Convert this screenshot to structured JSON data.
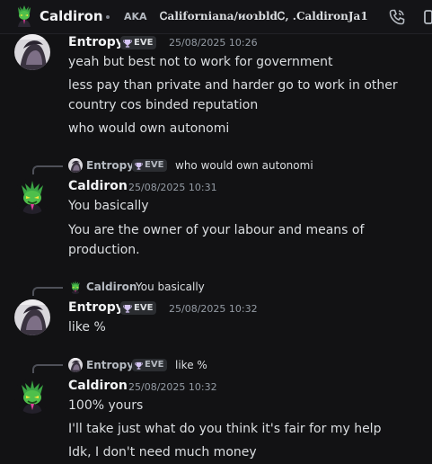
{
  "header": {
    "name": "Caldiron",
    "aka_label": "AKA",
    "alias": "Ꮯaliforniana/ᴎoɿbldᏟ, .CaldironJa1",
    "call_icon": "phone-call-icon",
    "more_icon": "more-icon"
  },
  "colors": {
    "background": "#121214",
    "badge_background": "#2b2d31",
    "timestamp": "#949ba4",
    "text": "#dbdee1"
  },
  "messages": [
    {
      "author": "Entropy",
      "badge": "EVE",
      "timestamp": "25/08/2025 10:26",
      "lines": [
        "yeah but best not to work for government",
        "less pay than private and harder go to work in other",
        "country cos binded reputation",
        "who would own autonomi"
      ]
    },
    {
      "reply": {
        "author": "Entropy",
        "badge": "EVE",
        "text": "who would own autonomi"
      },
      "author": "Caldiron",
      "timestamp": "25/08/2025 10:31",
      "lines": [
        "You basically",
        "You are the owner of your labour and means of",
        "production."
      ]
    },
    {
      "reply": {
        "author": "Caldiron",
        "text": "You basically"
      },
      "author": "Entropy",
      "badge": "EVE",
      "timestamp": "25/08/2025 10:32",
      "lines": [
        "like %"
      ]
    },
    {
      "reply": {
        "author": "Entropy",
        "badge": "EVE",
        "text": "like %"
      },
      "author": "Caldiron",
      "timestamp": "25/08/2025 10:32",
      "lines": [
        "100% yours",
        "I'll take just what do you think it's fair for my help",
        "Idk, I don't need much money"
      ]
    }
  ]
}
